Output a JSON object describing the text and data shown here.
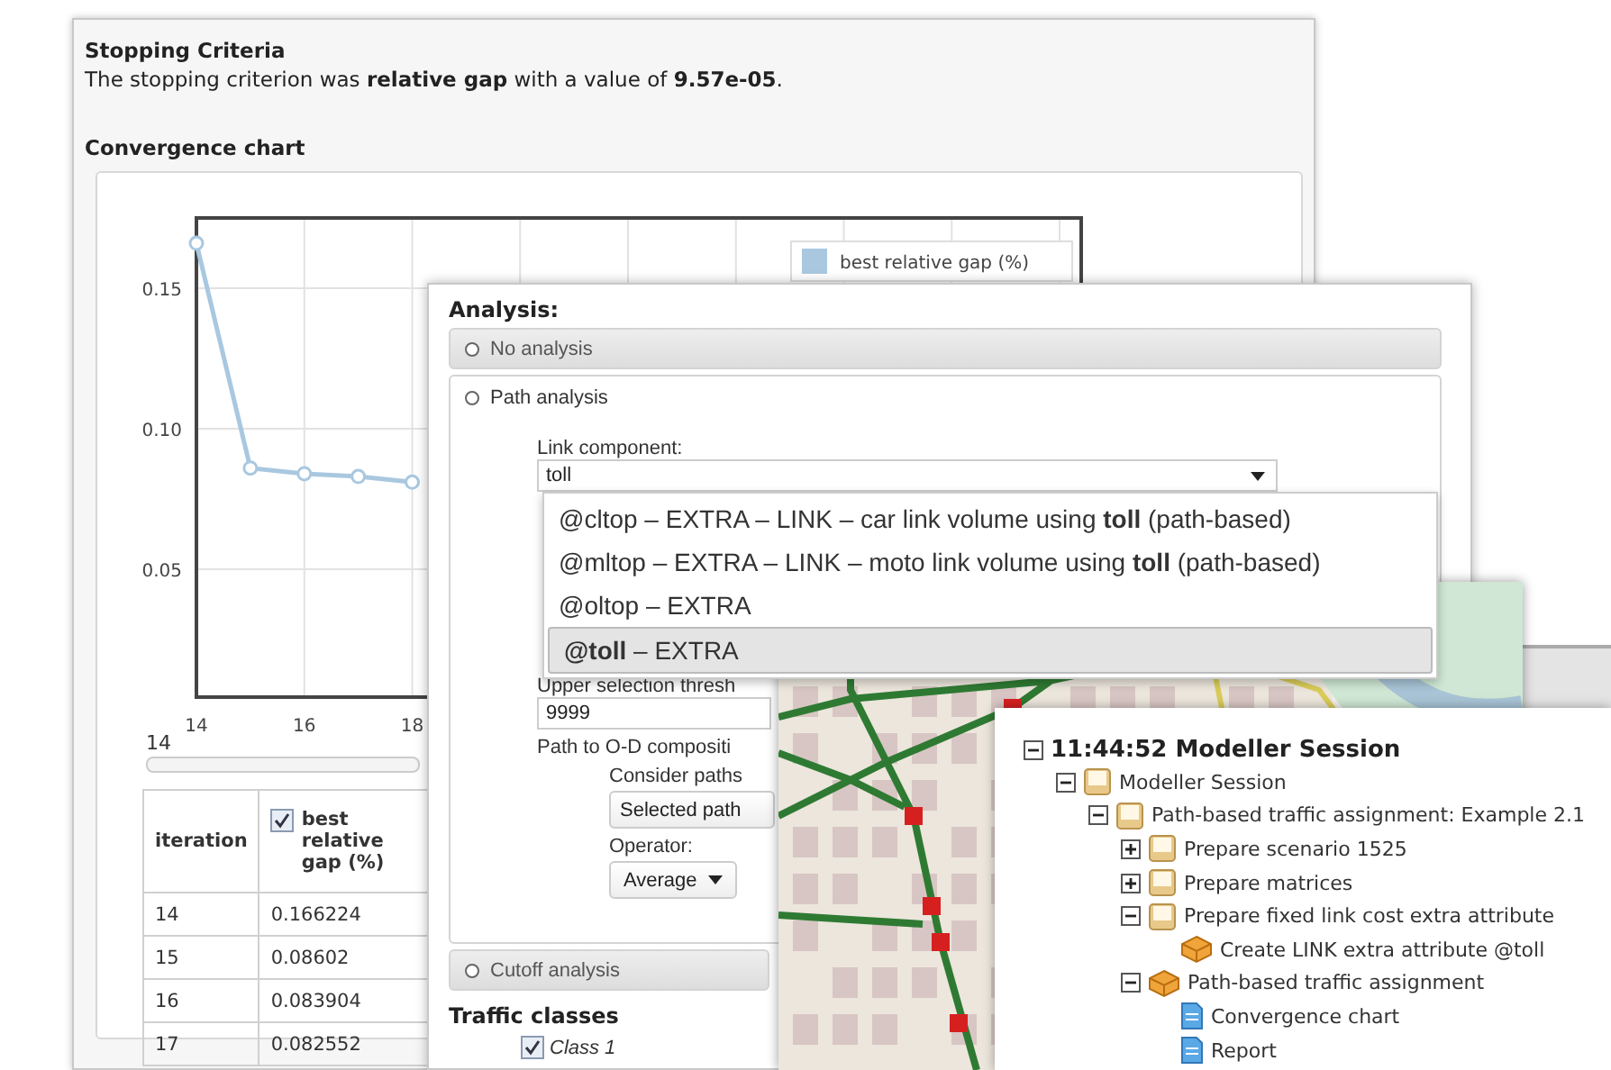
{
  "report": {
    "heading": "Stopping Criteria",
    "sentence": "The stopping criterion was **relative gap** with a value of **9.57e-05**.",
    "chart_heading": "Convergence chart",
    "chart": {
      "chart_data": {
        "type": "line",
        "grid": true,
        "x": [
          14,
          15,
          16,
          17,
          18
        ],
        "series": [
          {
            "name": "best relative gap (%)",
            "color": "#a9c8e0",
            "marker": "circle",
            "values": [
              0.166,
              0.086,
              0.084,
              0.083,
              0.081
            ]
          }
        ],
        "xlim": [
          14,
          30.4
        ],
        "ylim": [
          0.0045,
          0.175
        ],
        "xticks": [
          14,
          16,
          18
        ],
        "yticks": [
          {
            "value": 0.05,
            "label": "0.05"
          },
          {
            "value": 0.1,
            "label": "0.10"
          },
          {
            "value": 0.15,
            "label": "0.15"
          }
        ]
      }
    },
    "range_label": "14",
    "range_slider": {
      "level": 0
    },
    "table": {
      "columns": [
        {
          "label": "iteration"
        },
        {
          "label": "best relative gap (%)",
          "checked": true
        }
      ],
      "rows": [
        [
          "14",
          "0.166224"
        ],
        [
          "15",
          "0.08602"
        ],
        [
          "16",
          "0.083904"
        ],
        [
          "17",
          "0.082552"
        ]
      ]
    }
  },
  "analysis": {
    "title": "Analysis:",
    "sections": [
      {
        "label": "No analysis",
        "expanded": false
      },
      {
        "label": "Path analysis",
        "expanded": true
      },
      {
        "label": "Cutoff analysis",
        "expanded": false
      }
    ],
    "path_form": {
      "link_component": {
        "label": "Link component:",
        "value": "toll"
      },
      "options": [
        {
          "text": "@cltop – EXTRA – LINK – car link volume using **toll** (path-based)",
          "selected": false
        },
        {
          "text": "@mltop – EXTRA – LINK – moto link volume using **toll** (path-based)",
          "selected": false
        },
        {
          "text": "@oltop – EXTRA",
          "selected": false
        },
        {
          "text": "**@toll** – EXTRA",
          "selected": true
        }
      ],
      "threshold": {
        "label": "Upper selection thresh",
        "value": "9999"
      },
      "composition_label": "Path to O-D compositi",
      "consider": {
        "label": "Consider paths",
        "value": "Selected path"
      },
      "operator": {
        "label": "Operator:",
        "value": "Average"
      }
    },
    "traffic_classes": {
      "title": "Traffic classes",
      "items": [
        {
          "label": "Class 1",
          "checked": true
        }
      ]
    }
  },
  "tree": {
    "label": "11:44:52 Modeller Session",
    "expanded": true,
    "children": [
      {
        "label": "Modeller Session",
        "kind": "folder",
        "expanded": true,
        "children": [
          {
            "label": "Path-based traffic assignment: Example 2.1",
            "kind": "folder",
            "expanded": true,
            "children": [
              {
                "label": "Prepare scenario 1525",
                "kind": "folder",
                "expanded": false
              },
              {
                "label": "Prepare matrices",
                "kind": "folder",
                "expanded": false
              },
              {
                "label": "Prepare fixed link cost extra attribute",
                "kind": "folder",
                "expanded": true,
                "children": [
                  {
                    "label": "Create LINK extra attribute @toll",
                    "kind": "tool"
                  }
                ]
              },
              {
                "label": "Path-based traffic assignment",
                "kind": "tool",
                "expanded": true,
                "children": [
                  {
                    "label": "Convergence chart",
                    "kind": "document"
                  },
                  {
                    "label": "Report",
                    "kind": "document"
                  }
                ]
              }
            ]
          }
        ]
      }
    ]
  }
}
